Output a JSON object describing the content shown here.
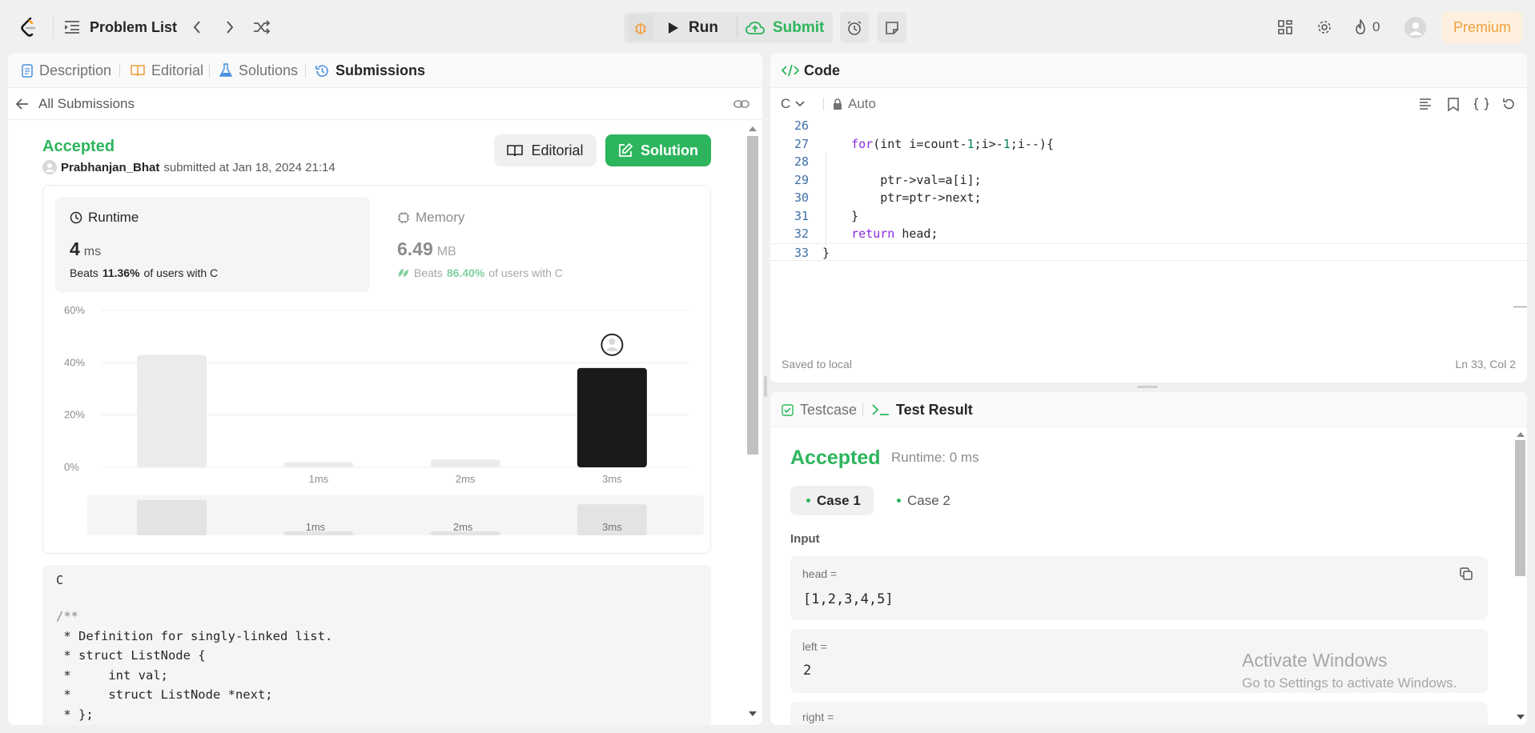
{
  "topbar": {
    "problem_list": "Problem List",
    "run": "Run",
    "submit": "Submit",
    "streak_count": "0",
    "premium": "Premium"
  },
  "left_tabs": [
    "Description",
    "Editorial",
    "Solutions",
    "Submissions"
  ],
  "submission": {
    "back_label": "All Submissions",
    "status": "Accepted",
    "user": "Prabhanjan_Bhat",
    "submitted_text": "submitted at Jan 18, 2024 21:14",
    "editorial_btn": "Editorial",
    "solution_btn": "Solution",
    "runtime_label": "Runtime",
    "runtime_value": "4",
    "runtime_unit": "ms",
    "runtime_beats_prefix": "Beats",
    "runtime_beats_pct": "11.36%",
    "runtime_beats_suffix": "of users with C",
    "memory_label": "Memory",
    "memory_value": "6.49",
    "memory_unit": "MB",
    "memory_beats_prefix": "Beats",
    "memory_beats_pct": "86.40%",
    "memory_beats_suffix": "of users with C",
    "code_lang": "C",
    "code_lines": [
      "/**",
      " * Definition for singly-linked list.",
      " * struct ListNode {",
      " *     int val;",
      " *     struct ListNode *next;",
      " * };"
    ]
  },
  "chart_data": {
    "type": "bar",
    "categories": [
      "",
      "1ms",
      "2ms",
      "3ms"
    ],
    "values": [
      43,
      2,
      3,
      38
    ],
    "highlight_index": 3,
    "yticks": [
      "0%",
      "20%",
      "40%",
      "60%"
    ],
    "ylim": [
      0,
      60
    ],
    "colors": {
      "bar": "#ebebeb",
      "highlight": "#1a1a1a"
    },
    "minimap_labels": [
      "",
      "1ms",
      "2ms",
      "3ms"
    ]
  },
  "code_panel": {
    "title": "Code",
    "language": "C",
    "mode": "Auto",
    "saved": "Saved to local",
    "position": "Ln 33, Col 2",
    "lines": [
      {
        "n": "26",
        "html": ""
      },
      {
        "n": "27",
        "html": "    <span class='kw'>for</span>(int i=count-<span class='num'>1</span>;i>-<span class='num'>1</span>;i--){"
      },
      {
        "n": "28",
        "html": ""
      },
      {
        "n": "29",
        "html": "        ptr->val=a[i];"
      },
      {
        "n": "30",
        "html": "        ptr=ptr->next;"
      },
      {
        "n": "31",
        "html": "    }"
      },
      {
        "n": "32",
        "html": "    <span class='kw'>return</span> head;"
      },
      {
        "n": "33",
        "html": "}"
      }
    ]
  },
  "test_panel": {
    "tab_testcase": "Testcase",
    "tab_result": "Test Result",
    "status": "Accepted",
    "runtime": "Runtime: 0 ms",
    "case1": "Case 1",
    "case2": "Case 2",
    "input_label": "Input",
    "head_label": "head =",
    "head_value": "[1,2,3,4,5]",
    "left_label": "left =",
    "left_value": "2",
    "right_label": "right ="
  },
  "watermark": {
    "line1": "Activate Windows",
    "line2": "Go to Settings to activate Windows."
  },
  "colors": {
    "accent_green": "#2db55d",
    "submit_green": "#2db55d",
    "premium_bg": "#fdf0df",
    "premium_text": "#f0a03c"
  }
}
